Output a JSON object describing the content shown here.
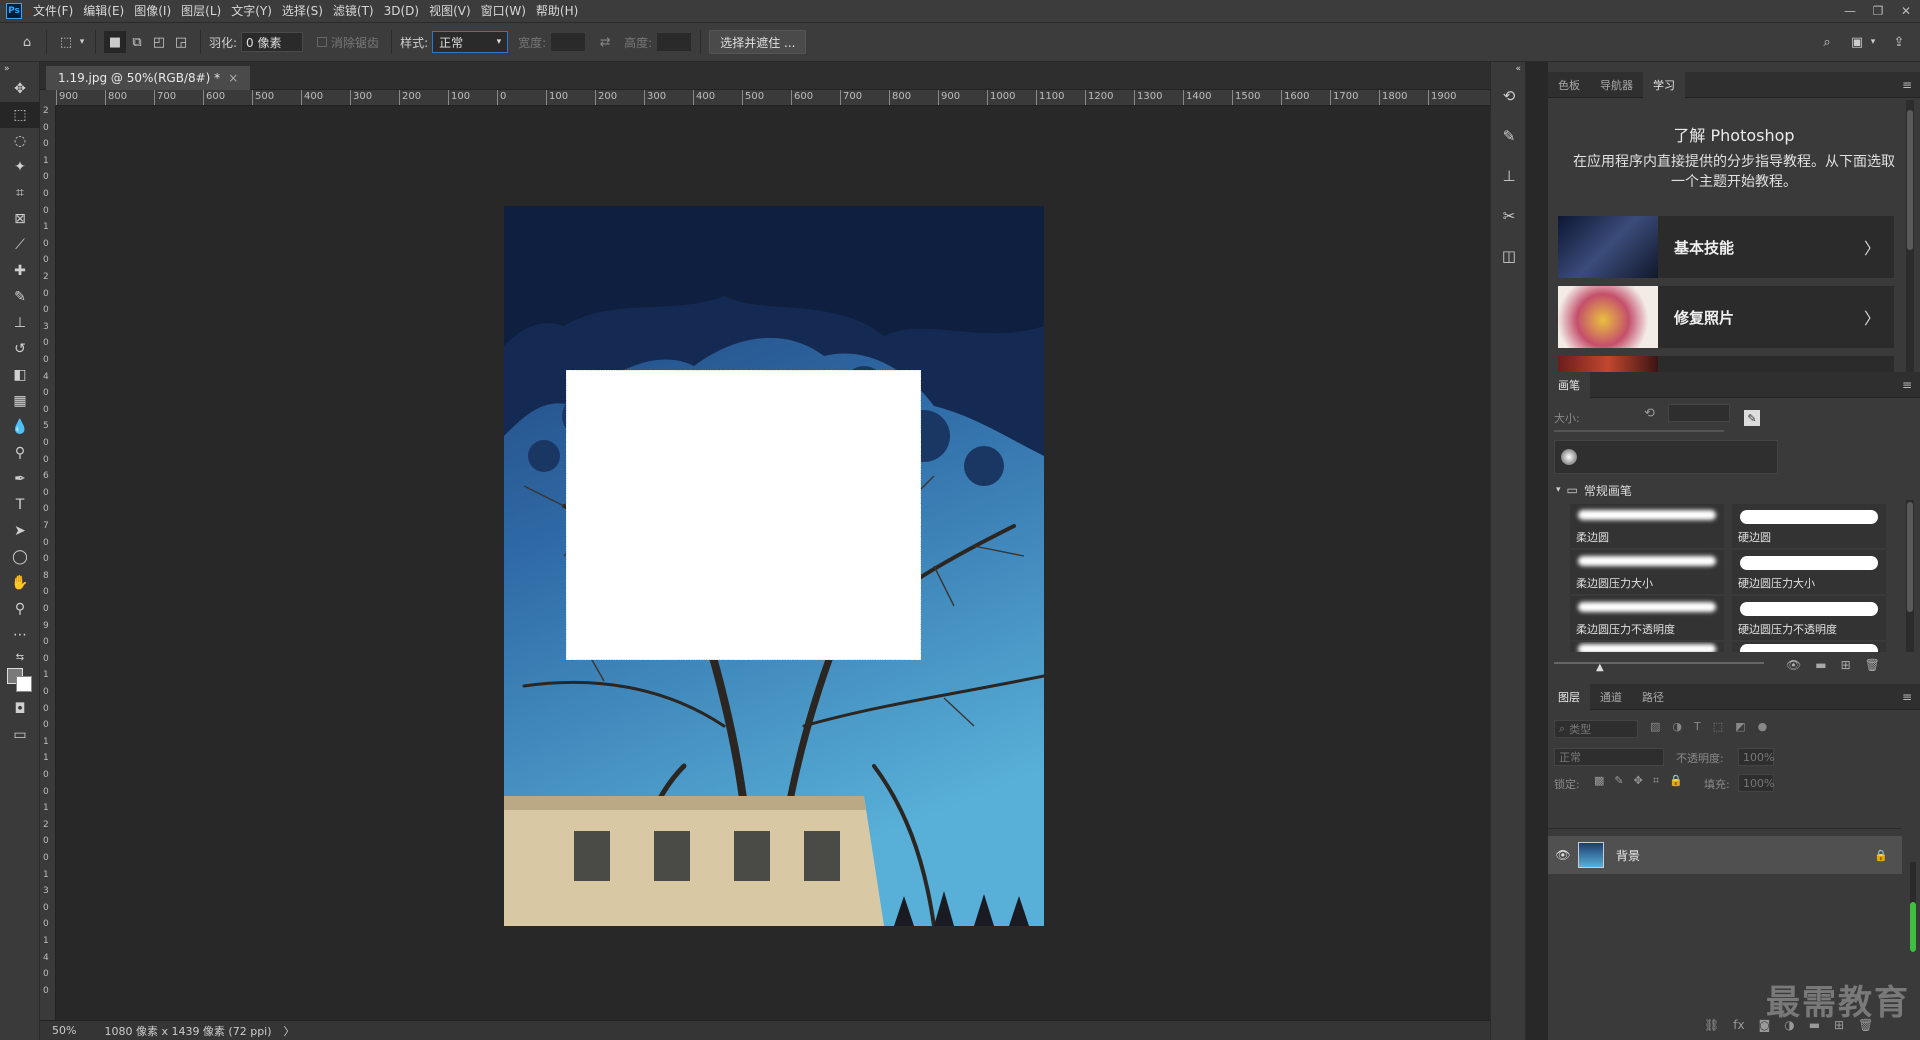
{
  "menubar": {
    "logo": "Ps",
    "items": [
      "文件(F)",
      "编辑(E)",
      "图像(I)",
      "图层(L)",
      "文字(Y)",
      "选择(S)",
      "滤镜(T)",
      "3D(D)",
      "视图(V)",
      "窗口(W)",
      "帮助(H)"
    ],
    "controls": {
      "minimize": "—",
      "restore": "❐",
      "close": "✕"
    }
  },
  "options": {
    "feather_label": "羽化:",
    "feather_value": "0 像素",
    "antialias_label": "消除锯齿",
    "style_label": "样式:",
    "style_value": "正常",
    "width_label": "宽度:",
    "height_label": "高度:",
    "select_mask_button": "选择并遮住 ..."
  },
  "document": {
    "tab_title": "1.19.jpg @ 50%(RGB/8#) *",
    "close": "×"
  },
  "rulers": {
    "horizontal": [
      "900",
      "800",
      "700",
      "600",
      "500",
      "400",
      "300",
      "200",
      "100",
      "0",
      "100",
      "200",
      "300",
      "400",
      "500",
      "600",
      "700",
      "800",
      "900",
      "1000",
      "1100",
      "1200",
      "1300",
      "1400",
      "1500",
      "1600",
      "1700",
      "1800",
      "1900"
    ],
    "vertical": [
      "2",
      "0",
      "0",
      "1",
      "0",
      "0",
      "0",
      "1",
      "0",
      "0",
      "2",
      "0",
      "0",
      "3",
      "0",
      "0",
      "4",
      "0",
      "0",
      "5",
      "0",
      "0",
      "6",
      "0",
      "0",
      "7",
      "0",
      "0",
      "8",
      "0",
      "0",
      "9",
      "0",
      "0",
      "1",
      "0",
      "0",
      "0",
      "1",
      "1",
      "0",
      "0",
      "1",
      "2",
      "0",
      "0",
      "1",
      "3",
      "0",
      "0",
      "1",
      "4",
      "0",
      "0"
    ]
  },
  "status": {
    "zoom": "50%",
    "info": "1080 像素 x 1439 像素 (72 ppi)",
    "arrow": "〉"
  },
  "learn_panel": {
    "tabs": [
      "色板",
      "导航器",
      "学习"
    ],
    "active_tab": "学习",
    "title": "了解 Photoshop",
    "description": "在应用程序内直接提供的分步指导教程。从下面选取一个主题开始教程。",
    "cards": [
      {
        "label": "基本技能",
        "arrow": "〉"
      },
      {
        "label": "修复照片",
        "arrow": "〉"
      }
    ]
  },
  "brush_panel": {
    "tab": "画笔",
    "size_label": "大小:",
    "group_name": "常规画笔",
    "brushes": [
      "柔边圆",
      "硬边圆",
      "柔边圆压力大小",
      "硬边圆压力大小",
      "柔边圆压力不透明度",
      "硬边圆压力不透明度"
    ]
  },
  "layers_panel": {
    "tabs": [
      "图层",
      "通道",
      "路径"
    ],
    "active_tab": "图层",
    "filter_placeholder": "类型",
    "blend_mode": "正常",
    "opacity_label": "不透明度:",
    "opacity_value": "100%",
    "lock_label": "锁定:",
    "fill_label": "填充:",
    "fill_value": "100%",
    "layer_name": "背景"
  },
  "watermark": "最需教育",
  "colors": {
    "accent": "#2b78d0",
    "panel_bg": "#3a3a3a",
    "canvas_bg": "#282828"
  }
}
